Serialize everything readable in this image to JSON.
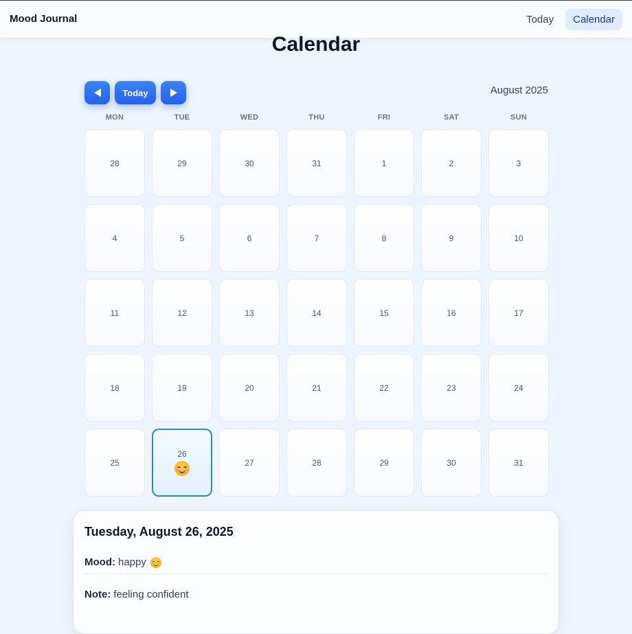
{
  "header": {
    "app_title": "Mood Journal",
    "nav": [
      {
        "label": "Today",
        "active": false
      },
      {
        "label": "Calendar",
        "active": true
      }
    ]
  },
  "page": {
    "title": "Calendar"
  },
  "controls": {
    "prev_icon": "triangle-left-icon",
    "today_label": "Today",
    "next_icon": "triangle-right-icon",
    "month_label": "August 2025"
  },
  "weekdays": [
    "MON",
    "TUE",
    "WED",
    "THU",
    "FRI",
    "SAT",
    "SUN"
  ],
  "calendar": {
    "days": [
      {
        "num": "28",
        "other_month": true
      },
      {
        "num": "29",
        "other_month": true
      },
      {
        "num": "30",
        "other_month": true
      },
      {
        "num": "31",
        "other_month": true
      },
      {
        "num": "1"
      },
      {
        "num": "2"
      },
      {
        "num": "3"
      },
      {
        "num": "4"
      },
      {
        "num": "5"
      },
      {
        "num": "6"
      },
      {
        "num": "7"
      },
      {
        "num": "8"
      },
      {
        "num": "9"
      },
      {
        "num": "10"
      },
      {
        "num": "11"
      },
      {
        "num": "12"
      },
      {
        "num": "13"
      },
      {
        "num": "14"
      },
      {
        "num": "15"
      },
      {
        "num": "16"
      },
      {
        "num": "17"
      },
      {
        "num": "18"
      },
      {
        "num": "19"
      },
      {
        "num": "20"
      },
      {
        "num": "21"
      },
      {
        "num": "22"
      },
      {
        "num": "23"
      },
      {
        "num": "24"
      },
      {
        "num": "25"
      },
      {
        "num": "26",
        "selected": true,
        "mood_icon": "smiling-face-icon"
      },
      {
        "num": "27"
      },
      {
        "num": "28"
      },
      {
        "num": "29"
      },
      {
        "num": "30"
      },
      {
        "num": "31"
      }
    ]
  },
  "detail": {
    "date": "Tuesday, August 26, 2025",
    "mood_label": "Mood:",
    "mood_value": "happy",
    "mood_icon": "smiling-face-icon",
    "note_label": "Note:",
    "note_value": "feeling confident"
  },
  "colors": {
    "accent": "#2563eb",
    "selected_border": "#2b86d6",
    "background": "#eef5fe"
  }
}
